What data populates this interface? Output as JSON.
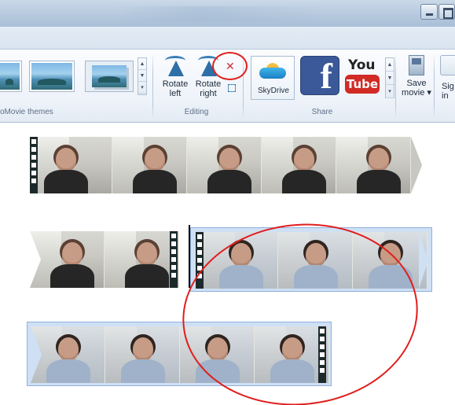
{
  "ribbon": {
    "themes_group_label": "oMovie themes",
    "editing_group_label": "Editing",
    "share_group_label": "Share",
    "rotate_left_label": [
      "Rotate",
      "left"
    ],
    "rotate_right_label": [
      "Rotate",
      "right"
    ],
    "skydrive_label": "SkyDrive",
    "youtube_you": "You",
    "youtube_tube": "Tube",
    "facebook_glyph": "f",
    "save_movie_label": [
      "Save",
      "movie ▾"
    ],
    "sign_in_label": [
      "Sig",
      "in"
    ]
  },
  "icons": {
    "minimize": "minimize-icon",
    "maximize": "maximize-icon",
    "remove": "remove-x-icon",
    "select": "select-box-icon"
  },
  "colors": {
    "annotation_red": "#e21d1d",
    "selection_blue": "#cfe0f4",
    "facebook_blue": "#3b5998",
    "youtube_red": "#d22a25"
  },
  "storyboard": {
    "clips": [
      {
        "name": "clip-1",
        "frames": 5,
        "selected": false,
        "tone": "dark"
      },
      {
        "name": "clip-2",
        "frames": 2,
        "selected": false,
        "tone": "dark"
      },
      {
        "name": "clip-3",
        "frames": 3,
        "selected": true,
        "tone": "blue"
      },
      {
        "name": "clip-4",
        "frames": 4,
        "selected": true,
        "tone": "blue"
      }
    ]
  }
}
